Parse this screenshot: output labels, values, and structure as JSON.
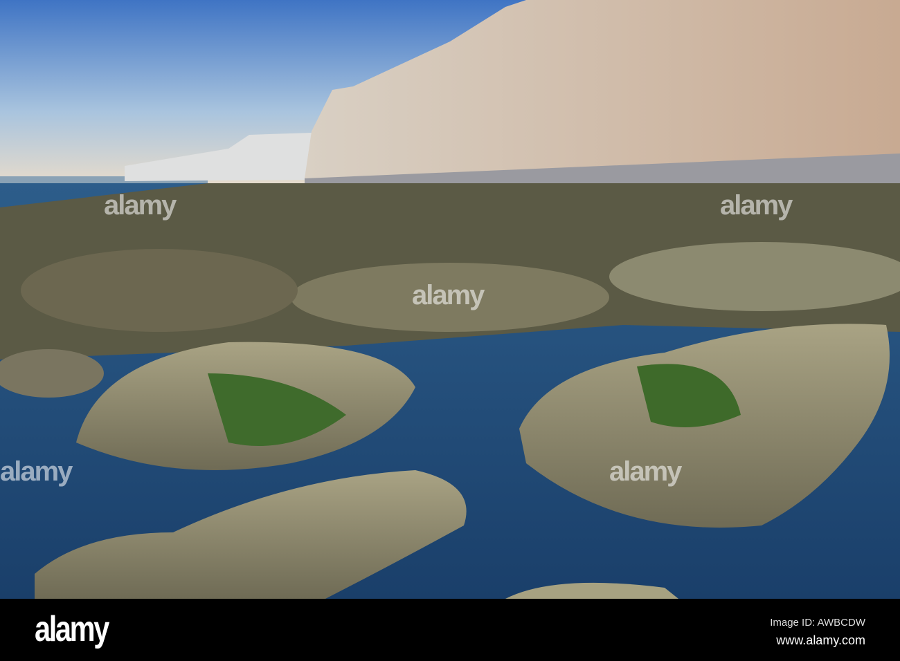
{
  "watermark": {
    "brand": "alamy"
  },
  "footer": {
    "logo": "alamy",
    "image_id": "Image ID: AWBCDW",
    "url": "www.alamy.com"
  }
}
